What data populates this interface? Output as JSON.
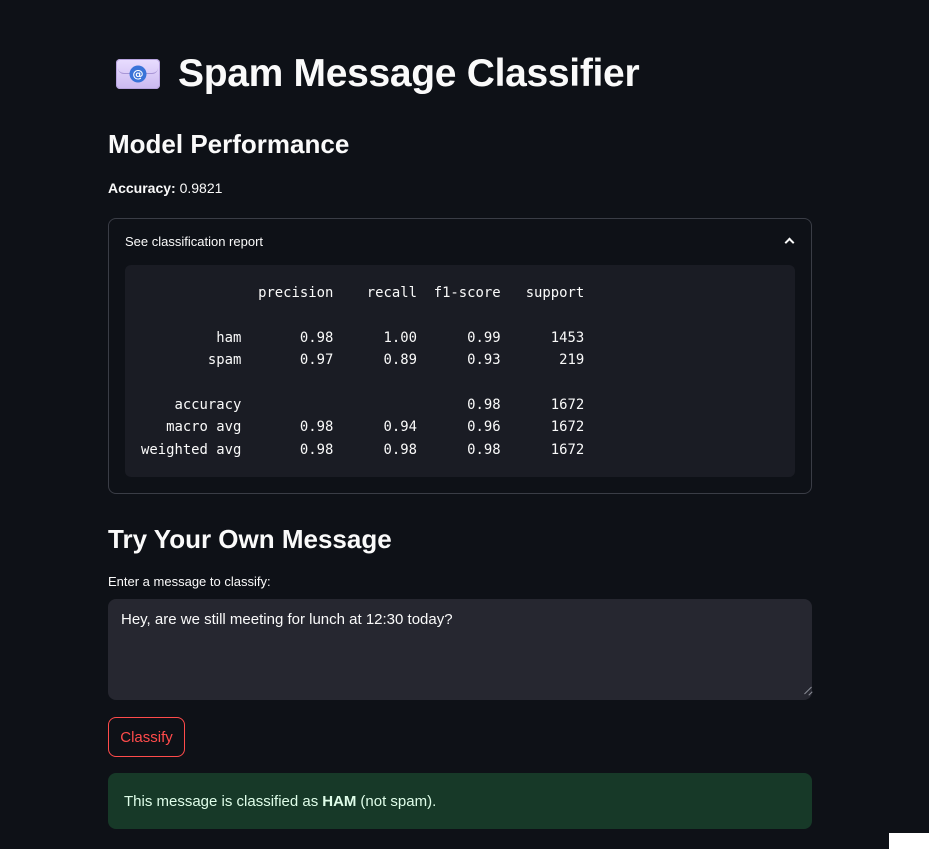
{
  "app": {
    "icon": "email-at-icon",
    "title": "Spam Message Classifier"
  },
  "performance": {
    "heading": "Model Performance",
    "accuracy_label": "Accuracy:",
    "accuracy_value": "0.9821"
  },
  "report": {
    "expander_label": "See classification report",
    "expanded": true,
    "text": "              precision    recall  f1-score   support\n\n         ham       0.98      1.00      0.99      1453\n        spam       0.97      0.89      0.93       219\n\n    accuracy                           0.98      1672\n   macro avg       0.98      0.94      0.96      1672\nweighted avg       0.98      0.98      0.98      1672"
  },
  "try_section": {
    "heading": "Try Your Own Message",
    "input_label": "Enter a message to classify:",
    "input_value": "Hey, are we still meeting for lunch at 12:30 today?",
    "button_label": "Classify"
  },
  "result": {
    "prefix": "This message is classified as",
    "label": "HAM",
    "suffix": "(not spam)."
  },
  "colors": {
    "background": "#0e1117",
    "accent": "#ff4b4b",
    "success_bg": "#173928",
    "success_text": "#dffde9"
  }
}
